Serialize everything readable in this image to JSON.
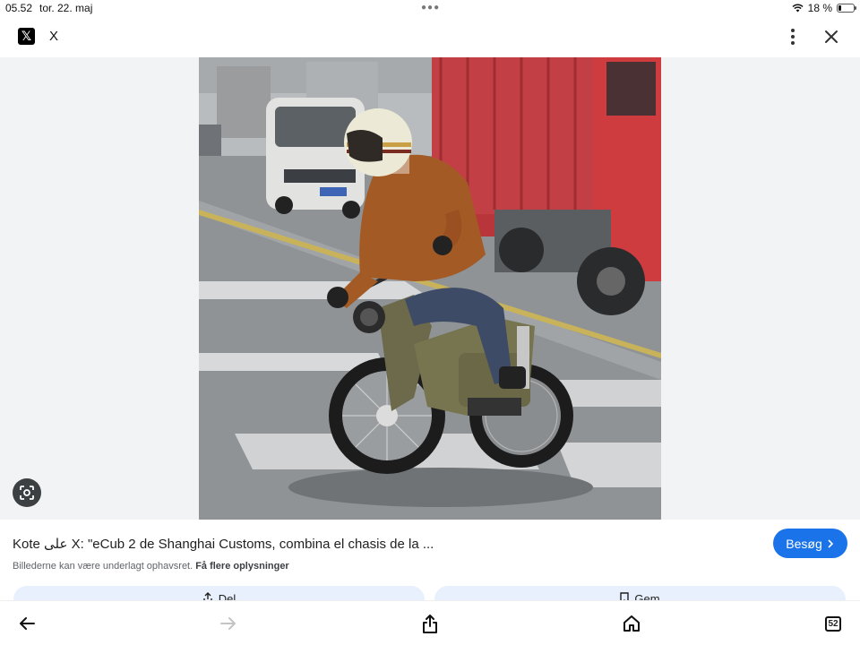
{
  "status_bar": {
    "time": "05.52",
    "date": "tor. 22. maj",
    "battery": "18 %",
    "battery_level": 0.18
  },
  "header": {
    "site_name": "X",
    "logo_glyph": "𝕏",
    "menu_icon": "more-vert-icon",
    "close_icon": "close-icon"
  },
  "result": {
    "title": "Kote على X: \"eCub 2 de Shanghai Customs, combina el chasis de la ...",
    "visit_label": "Besøg",
    "copyright_note": "Billederne kan være underlagt ophavsret.",
    "more_info_label": "Få flere oplysninger"
  },
  "actions": {
    "share_label": "Del",
    "save_label": "Gem"
  },
  "toolbar": {
    "tabs_count": "52"
  },
  "colors": {
    "accent": "#1a73e8",
    "action_bg": "#e8f0fe",
    "viewer_bg": "#f1f3f4"
  }
}
